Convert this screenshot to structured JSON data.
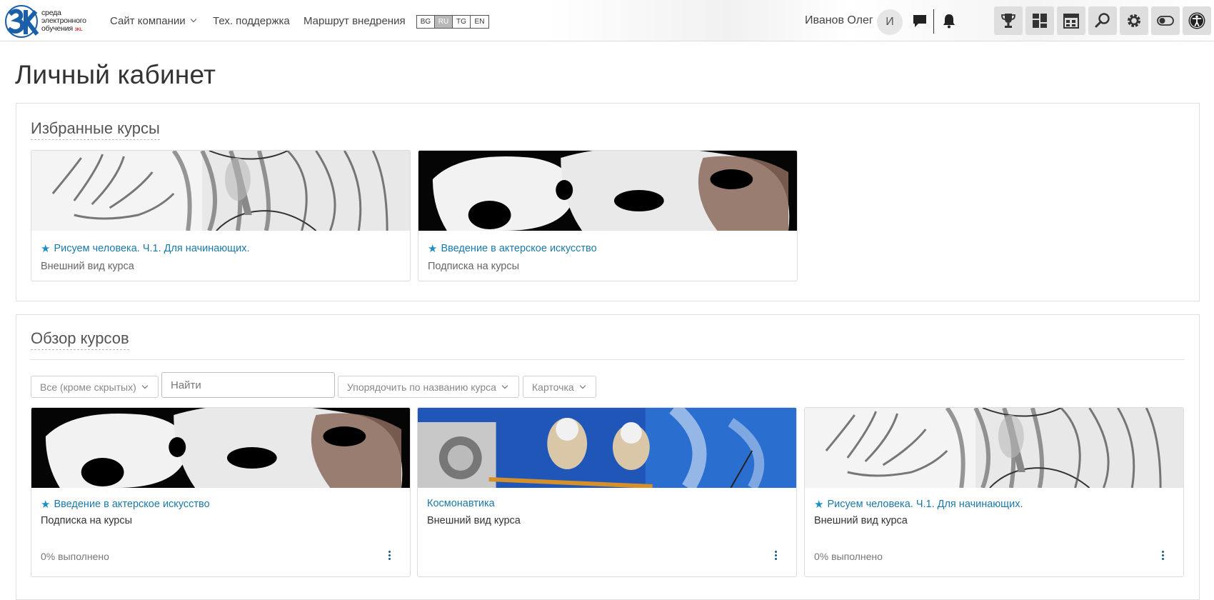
{
  "logo": {
    "line1": "среда",
    "line2": "электронного",
    "line3": "обучения",
    "badge": "3KL"
  },
  "nav": {
    "company_site": "Сайт компании",
    "support": "Тех. поддержка",
    "route": "Маршрут внедрения"
  },
  "languages": [
    {
      "code": "BG"
    },
    {
      "code": "RU",
      "active": true
    },
    {
      "code": "TG"
    },
    {
      "code": "EN"
    }
  ],
  "user": {
    "name": "Иванов Олег",
    "initial": "И"
  },
  "toolbar": {
    "icons": [
      "trophy-icon",
      "dashboard-icon",
      "calendar-icon",
      "search-icon",
      "gear-icon",
      "toggle-icon",
      "accessibility-icon"
    ]
  },
  "page": {
    "title": "Личный кабинет"
  },
  "favorites": {
    "title": "Избранные курсы",
    "cards": [
      {
        "title": "Рисуем человека. Ч.1. Для начинающих.",
        "category": "Внешний вид курса",
        "image": "drawing"
      },
      {
        "title": "Введение в актерское искусство",
        "category": "Подписка на курсы",
        "image": "masks"
      }
    ]
  },
  "overview": {
    "title": "Обзор курсов",
    "filter_all": "Все (кроме скрытых)",
    "search_placeholder": "Найти",
    "sort": "Упорядочить по названию курса",
    "view": "Карточка",
    "cards": [
      {
        "title": "Введение в актерское искусство",
        "category": "Подписка на курсы",
        "progress": "0% выполнено",
        "starred": true,
        "image": "masks"
      },
      {
        "title": "Космонавтика",
        "category": "Внешний вид курса",
        "progress": "",
        "starred": false,
        "image": "space"
      },
      {
        "title": "Рисуем человека. Ч.1. Для начинающих.",
        "category": "Внешний вид курса",
        "progress": "0% выполнено",
        "starred": true,
        "image": "drawing"
      }
    ]
  },
  "colors": {
    "link": "#1b79a8",
    "star": "#1a8fc4",
    "toolbar_button": "#dedede"
  }
}
